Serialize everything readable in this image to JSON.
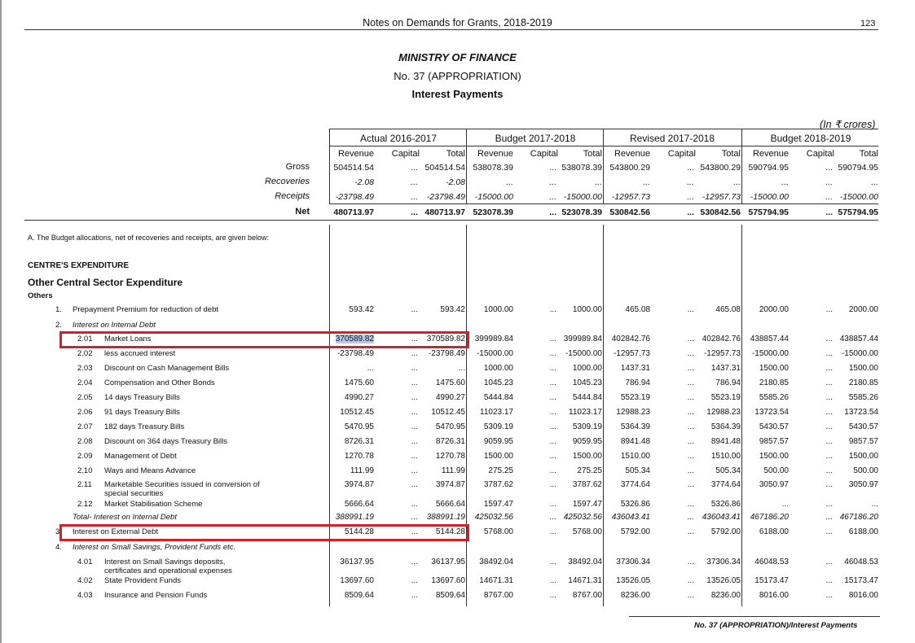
{
  "header": {
    "title": "Notes on Demands for Grants, 2018-2019",
    "page": "123"
  },
  "doc": {
    "ministry": "MINISTRY OF FINANCE",
    "demand": "No. 37 (APPROPRIATION)",
    "subtitle": "Interest Payments",
    "units": "(In ₹ crores)"
  },
  "columns": {
    "groups": [
      "Actual 2016-2017",
      "Budget 2017-2018",
      "Revised 2017-2018",
      "Budget 2018-2019"
    ],
    "sub": [
      "Revenue",
      "Capital",
      "Total"
    ]
  },
  "summary": [
    {
      "label": "Gross",
      "style": "",
      "vals": [
        "504514.54",
        "...",
        "504514.54",
        "538078.39",
        "...",
        "538078.39",
        "543800.29",
        "...",
        "543800.29",
        "590794.95",
        "...",
        "590794.95"
      ]
    },
    {
      "label": "Recoveries",
      "style": "i",
      "vals": [
        "-2.08",
        "...",
        "-2.08",
        "...",
        "...",
        "...",
        "...",
        "...",
        "...",
        "...",
        "...",
        "..."
      ]
    },
    {
      "label": "Receipts",
      "style": "i",
      "vals": [
        "-23798.49",
        "...",
        "-23798.49",
        "-15000.00",
        "...",
        "-15000.00",
        "-12957.73",
        "...",
        "-12957.73",
        "-15000.00",
        "...",
        "-15000.00"
      ]
    },
    {
      "label": "Net",
      "style": "b",
      "vals": [
        "480713.97",
        "...",
        "480713.97",
        "523078.39",
        "...",
        "523078.39",
        "530842.56",
        "...",
        "530842.56",
        "575794.95",
        "...",
        "575794.95"
      ]
    }
  ],
  "section": {
    "note": "A. The Budget allocations, net of recoveries and receipts, are given below:",
    "centre": "CENTRE'S EXPENDITURE",
    "other": "Other Central Sector Expenditure",
    "others": "Others"
  },
  "rows": [
    {
      "num": "1.",
      "label": "Prepayment Premium for reduction of debt",
      "vals": [
        "593.42",
        "...",
        "593.42",
        "1000.00",
        "...",
        "1000.00",
        "465.08",
        "...",
        "465.08",
        "2000.00",
        "...",
        "2000.00"
      ]
    },
    {
      "num": "2.",
      "label": "Interest on Internal Debt",
      "italic": true,
      "vals": []
    },
    {
      "num": "2.01",
      "label": "Market Loans",
      "vals": [
        "370589.82",
        "...",
        "370589.82",
        "399989.84",
        "...",
        "399989.84",
        "402842.76",
        "...",
        "402842.76",
        "438857.44",
        "...",
        "438857.44"
      ]
    },
    {
      "num": "2.02",
      "label": "less accrued interest",
      "vals": [
        "-23798.49",
        "...",
        "-23798.49",
        "-15000.00",
        "...",
        "-15000.00",
        "-12957.73",
        "...",
        "-12957.73",
        "-15000.00",
        "...",
        "-15000.00"
      ]
    },
    {
      "num": "2.03",
      "label": "Discount on Cash Management Bills",
      "vals": [
        "...",
        "...",
        "...",
        "1000.00",
        "...",
        "1000.00",
        "1437.31",
        "...",
        "1437.31",
        "1500.00",
        "...",
        "1500.00"
      ]
    },
    {
      "num": "2.04",
      "label": "Compensation and Other Bonds",
      "vals": [
        "1475.60",
        "...",
        "1475.60",
        "1045.23",
        "...",
        "1045.23",
        "786.94",
        "...",
        "786.94",
        "2180.85",
        "...",
        "2180.85"
      ]
    },
    {
      "num": "2.05",
      "label": "14 days Treasury Bills",
      "vals": [
        "4990.27",
        "...",
        "4990.27",
        "5444.84",
        "...",
        "5444.84",
        "5523.19",
        "...",
        "5523.19",
        "5585.26",
        "...",
        "5585.26"
      ]
    },
    {
      "num": "2.06",
      "label": "91 days Treasury Bills",
      "vals": [
        "10512.45",
        "...",
        "10512.45",
        "11023.17",
        "...",
        "11023.17",
        "12988.23",
        "...",
        "12988.23",
        "13723.54",
        "...",
        "13723.54"
      ]
    },
    {
      "num": "2.07",
      "label": "182 days Treasury Bills",
      "vals": [
        "5470.95",
        "...",
        "5470.95",
        "5309.19",
        "...",
        "5309.19",
        "5364.39",
        "...",
        "5364.39",
        "5430.57",
        "...",
        "5430.57"
      ]
    },
    {
      "num": "2.08",
      "label": "Discount on 364 days Treasury Bills",
      "vals": [
        "8726.31",
        "...",
        "8726.31",
        "9059.95",
        "...",
        "9059.95",
        "8941.48",
        "...",
        "8941.48",
        "9857.57",
        "...",
        "9857.57"
      ]
    },
    {
      "num": "2.09",
      "label": "Management of Debt",
      "vals": [
        "1270.78",
        "...",
        "1270.78",
        "1500.00",
        "...",
        "1500.00",
        "1510.00",
        "...",
        "1510.00",
        "1500.00",
        "...",
        "1500.00"
      ]
    },
    {
      "num": "2.10",
      "label": "Ways and Means Advance",
      "vals": [
        "111.99",
        "...",
        "111.99",
        "275.25",
        "...",
        "275.25",
        "505.34",
        "...",
        "505.34",
        "500.00",
        "...",
        "500.00"
      ]
    },
    {
      "num": "2.11",
      "label": "Marketable Securities issued in conversion of",
      "label2": "special securities",
      "vals": [
        "3974.87",
        "...",
        "3974.87",
        "3787.62",
        "...",
        "3787.62",
        "3774.64",
        "...",
        "3774.64",
        "3050.97",
        "...",
        "3050.97"
      ]
    },
    {
      "num": "2.12",
      "label": "Market Stabilisation Scheme",
      "vals": [
        "5666.64",
        "...",
        "5666.64",
        "1597.47",
        "...",
        "1597.47",
        "5326.86",
        "...",
        "5326.86",
        "...",
        "...",
        "..."
      ]
    },
    {
      "num": "",
      "label": "Total- Interest on Internal Debt",
      "italic": true,
      "vals": [
        "388991.19",
        "...",
        "388991.19",
        "425032.56",
        "...",
        "425032.56",
        "436043.41",
        "...",
        "436043.41",
        "467186.20",
        "...",
        "467186.20"
      ]
    },
    {
      "num": "3.",
      "label": "Interest on External Debt",
      "vals": [
        "5144.28",
        "...",
        "5144.28",
        "5768.00",
        "...",
        "5768.00",
        "5792.00",
        "...",
        "5792.00",
        "6188.00",
        "...",
        "6188.00"
      ]
    },
    {
      "num": "4.",
      "label": "Interest on Small Savings, Provident Funds etc.",
      "italic": true,
      "vals": []
    },
    {
      "num": "4.01",
      "label": "Interest on Small Savings deposits,",
      "label2": "certificates and operational expenses",
      "vals": [
        "36137.95",
        "...",
        "36137.95",
        "38492.04",
        "...",
        "38492.04",
        "37306.34",
        "...",
        "37306.34",
        "46048.53",
        "...",
        "46048.53"
      ]
    },
    {
      "num": "4.02",
      "label": "State Provident Funds",
      "vals": [
        "13697.60",
        "...",
        "13697.60",
        "14671.31",
        "...",
        "14671.31",
        "13526.05",
        "...",
        "13526.05",
        "15173.47",
        "...",
        "15173.47"
      ]
    },
    {
      "num": "4.03",
      "label": "Insurance and Pension Funds",
      "vals": [
        "8509.64",
        "...",
        "8509.64",
        "8767.00",
        "...",
        "8767.00",
        "8236.00",
        "...",
        "8236.00",
        "8016.00",
        "...",
        "8016.00"
      ]
    }
  ],
  "footer": {
    "text": "No. 37 (APPROPRIATION)/Interest Payments"
  }
}
